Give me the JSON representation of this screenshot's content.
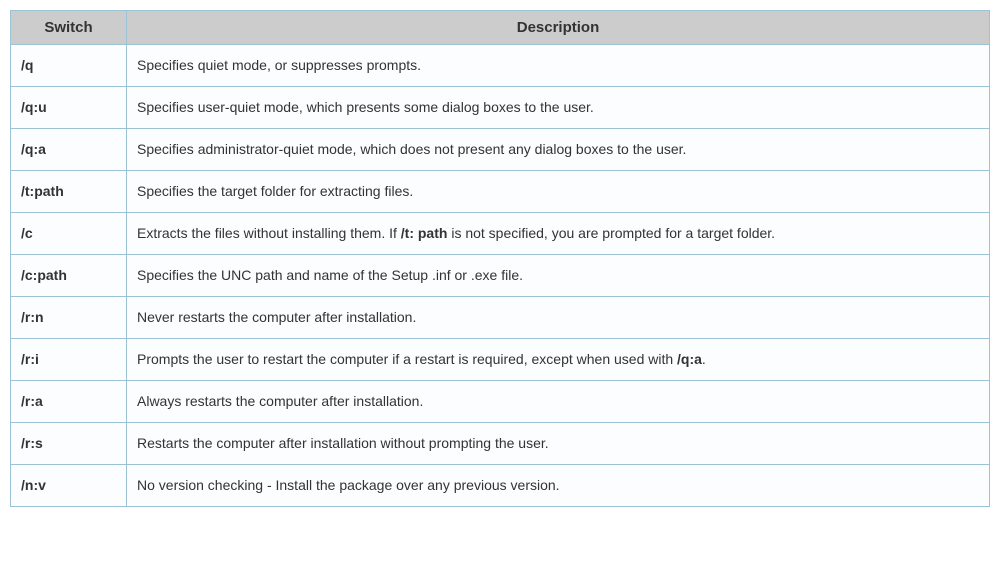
{
  "headers": {
    "switch": "Switch",
    "description": "Description"
  },
  "rows": [
    {
      "switch": "/q",
      "desc_parts": [
        {
          "text": "Specifies quiet mode, or suppresses prompts.",
          "bold": false
        }
      ]
    },
    {
      "switch": "/q:u",
      "desc_parts": [
        {
          "text": "Specifies user-quiet mode, which presents some dialog boxes to the user.",
          "bold": false
        }
      ]
    },
    {
      "switch": "/q:a",
      "desc_parts": [
        {
          "text": "Specifies administrator-quiet mode, which does not present any dialog boxes to the user.",
          "bold": false
        }
      ]
    },
    {
      "switch": "/t:path",
      "desc_parts": [
        {
          "text": "Specifies the target folder for extracting files.",
          "bold": false
        }
      ]
    },
    {
      "switch": "/c",
      "desc_parts": [
        {
          "text": "Extracts the files without installing them. If ",
          "bold": false
        },
        {
          "text": "/t: path",
          "bold": true
        },
        {
          "text": " is not specified, you are prompted for a target folder.",
          "bold": false
        }
      ]
    },
    {
      "switch": "/c:path",
      "desc_parts": [
        {
          "text": "Specifies the UNC path and name of the Setup .inf or .exe file.",
          "bold": false
        }
      ]
    },
    {
      "switch": "/r:n",
      "desc_parts": [
        {
          "text": "Never restarts the computer after installation.",
          "bold": false
        }
      ]
    },
    {
      "switch": "/r:i",
      "desc_parts": [
        {
          "text": "Prompts the user to restart the computer if a restart is required, except when used with ",
          "bold": false
        },
        {
          "text": "/q:a",
          "bold": true
        },
        {
          "text": ".",
          "bold": false
        }
      ]
    },
    {
      "switch": "/r:a",
      "desc_parts": [
        {
          "text": "Always restarts the computer after installation.",
          "bold": false
        }
      ]
    },
    {
      "switch": "/r:s",
      "desc_parts": [
        {
          "text": "Restarts the computer after installation without prompting the user.",
          "bold": false
        }
      ]
    },
    {
      "switch": "/n:v",
      "desc_parts": [
        {
          "text": "No version checking - Install the package over any previous version.",
          "bold": false
        }
      ]
    }
  ]
}
